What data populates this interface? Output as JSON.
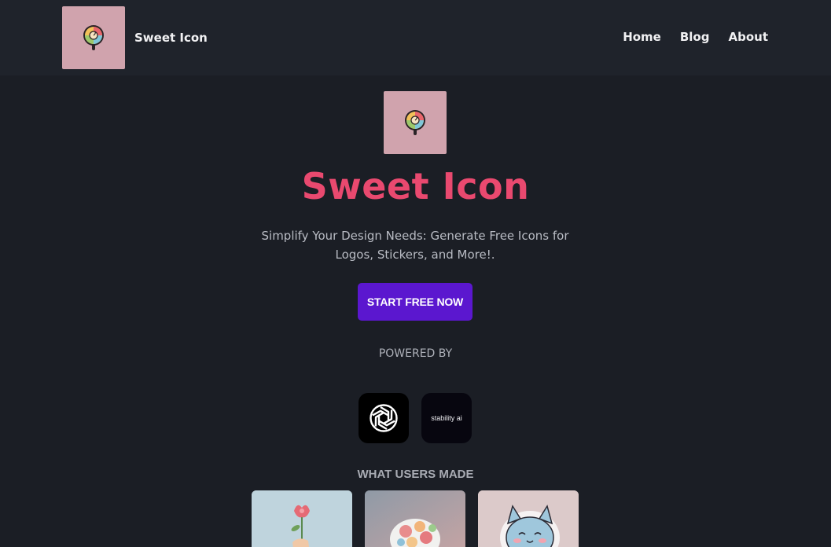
{
  "header": {
    "brand_name": "Sweet Icon",
    "nav": [
      "Home",
      "Blog",
      "About"
    ]
  },
  "hero": {
    "title": "Sweet Icon",
    "subtitle": "Simplify Your Design Needs: Generate Free Icons for Logos, Stickers, and More!.",
    "cta_label": "START FREE NOW"
  },
  "powered": {
    "label": "POWERED BY",
    "partners": [
      "openai-logo-icon",
      "stability ai"
    ]
  },
  "gallery": {
    "title": "WHAT USERS MADE",
    "items": [
      "flower-hand-icon",
      "flower-bouquet-sticker-icon",
      "cat-sticker-icon"
    ]
  },
  "colors": {
    "background": "#1b1e25",
    "header": "#1f232b",
    "accent_title": "#e9496f",
    "cta": "#5b17cf",
    "logo_bg": "#d0a3ad"
  }
}
